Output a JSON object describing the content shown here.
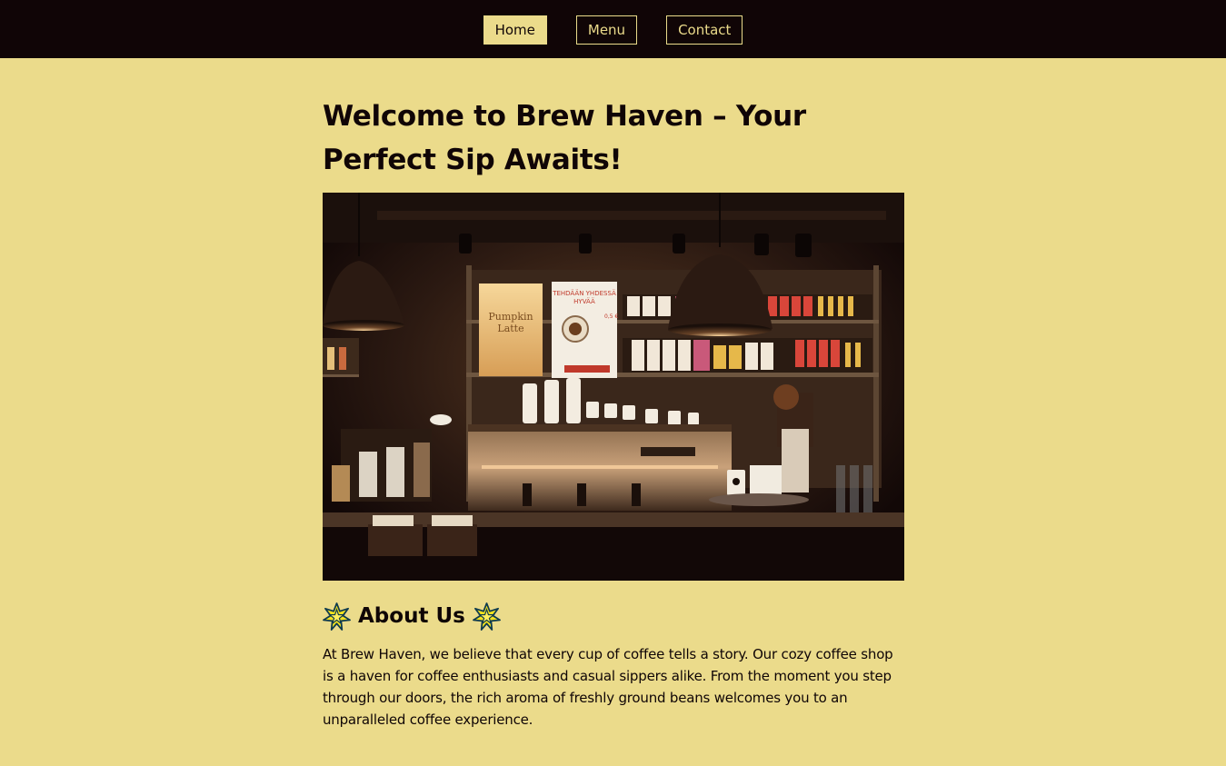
{
  "nav": {
    "items": [
      {
        "label": "Home",
        "active": true
      },
      {
        "label": "Menu",
        "active": false
      },
      {
        "label": "Contact",
        "active": false
      }
    ]
  },
  "main": {
    "title": "Welcome to Brew Haven – Your Perfect Sip Awaits!",
    "hero_image": {
      "sign_left": "Pumpkin Latte",
      "sign_right": "TEHDÄÄN YHDESSÄ HYVÄÄ",
      "price": "0,5 €"
    },
    "about": {
      "heading": "About Us",
      "icon": "star-icon",
      "paragraph": "At Brew Haven, we believe that every cup of coffee tells a story. Our cozy coffee shop is a haven for coffee enthusiasts and casual sippers alike. From the moment you step through our doors, the rich aroma of freshly ground beans welcomes you to an unparalleled coffee experience."
    }
  },
  "colors": {
    "background": "#ebdb8b",
    "navbar": "#100506",
    "text": "#100506",
    "star_fill": "#f4e21d",
    "star_outline": "#0e3a4e"
  }
}
